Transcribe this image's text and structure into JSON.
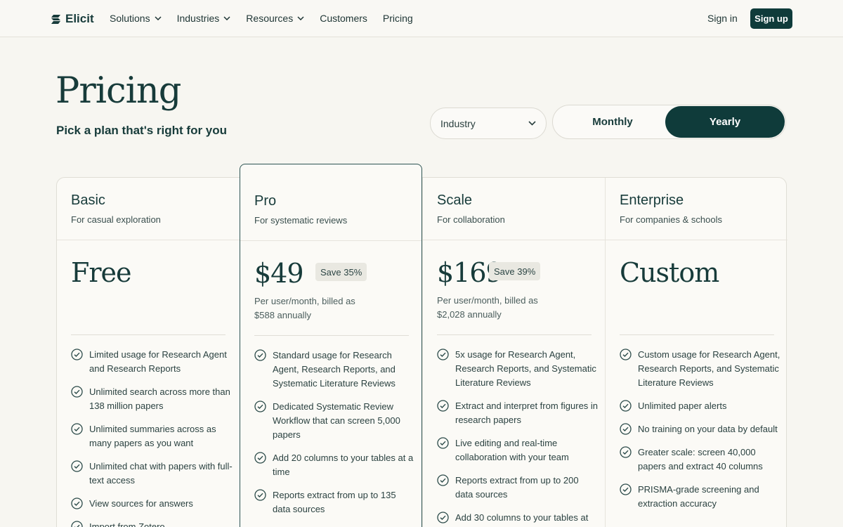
{
  "header": {
    "brand": "Elicit",
    "nav": [
      {
        "label": "Solutions",
        "has_dropdown": true
      },
      {
        "label": "Industries",
        "has_dropdown": true
      },
      {
        "label": "Resources",
        "has_dropdown": true
      },
      {
        "label": "Customers",
        "has_dropdown": false
      },
      {
        "label": "Pricing",
        "has_dropdown": false
      }
    ],
    "sign_in": "Sign in",
    "sign_up": "Sign up"
  },
  "hero": {
    "title": "Pricing",
    "subtitle": "Pick a plan that's right for you",
    "industry_select": "Industry",
    "billing": {
      "monthly": "Monthly",
      "yearly": "Yearly",
      "selected": "Yearly"
    }
  },
  "colors": {
    "accent": "#0f3b3a",
    "background": "#f7f6f1",
    "text": "#173b3a"
  },
  "plans": [
    {
      "name": "Basic",
      "description": "For casual exploration",
      "price": "Free",
      "features": [
        "Limited usage for Research Agent and Research Reports",
        "Unlimited search across more than 138 million papers",
        "Unlimited summaries across as many papers as you want",
        "Unlimited chat with papers with full-text access",
        "View sources for answers",
        "Import from Zotero"
      ]
    },
    {
      "name": "Pro",
      "description": "For systematic reviews",
      "price": "$49",
      "badge": "Save 35%",
      "billing_line1": "Per user/month, billed as",
      "billing_line2": "$588 annually",
      "features": [
        "Standard usage for Research Agent, Research Reports, and Systematic Literature Reviews",
        "Dedicated Systematic Review Workflow that can screen 5,000 papers",
        "Add 20 columns to your tables at a time",
        "Reports extract from up to 135 data sources"
      ]
    },
    {
      "name": "Scale",
      "description": "For collaboration",
      "price": "$169",
      "badge": "Save 39%",
      "billing_line1": "Per user/month, billed as",
      "billing_line2": "$2,028 annually",
      "features": [
        "5x usage for Research Agent, Research Reports, and Systematic Literature Reviews",
        "Extract and interpret from figures in research papers",
        "Live editing and real-time collaboration with your team",
        "Reports extract from up to 200 data sources",
        "Add 30 columns to your tables at"
      ]
    },
    {
      "name": "Enterprise",
      "description": "For companies & schools",
      "price": "Custom",
      "features": [
        "Custom usage for Research Agent, Research Reports, and Systematic Literature Reviews",
        "Unlimited paper alerts",
        "No training on your data by default",
        "Greater scale: screen 40,000 papers and extract 40 columns",
        "PRISMA-grade screening and extraction accuracy"
      ]
    }
  ]
}
